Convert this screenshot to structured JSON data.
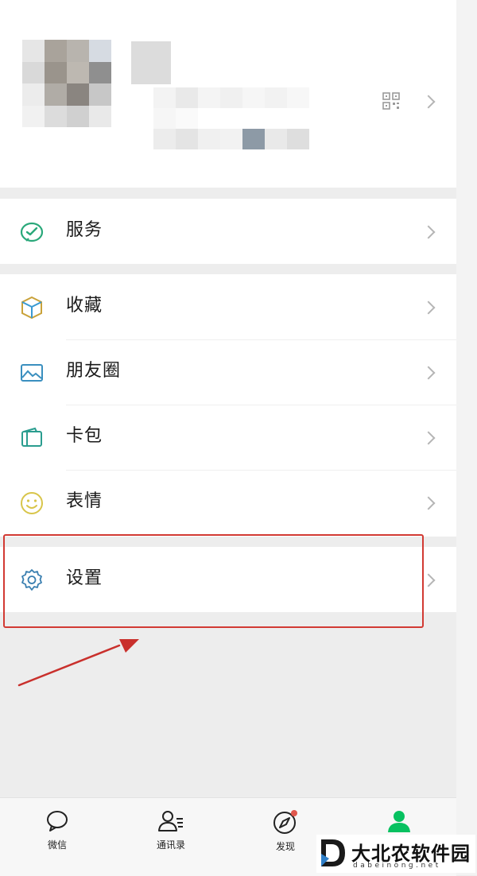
{
  "menu": {
    "services": "服务",
    "favorites": "收藏",
    "moments": "朋友圈",
    "cards": "卡包",
    "stickers": "表情",
    "settings": "设置"
  },
  "tabs": {
    "chats": "微信",
    "contacts": "通讯录",
    "discover": "发现",
    "me": ""
  },
  "watermark": {
    "name": "大北农软件园",
    "url": "dabeinong.net"
  },
  "colors": {
    "accent_green": "#07c160",
    "highlight_red": "#d23a33",
    "icon_teal": "#2a9d8f"
  }
}
